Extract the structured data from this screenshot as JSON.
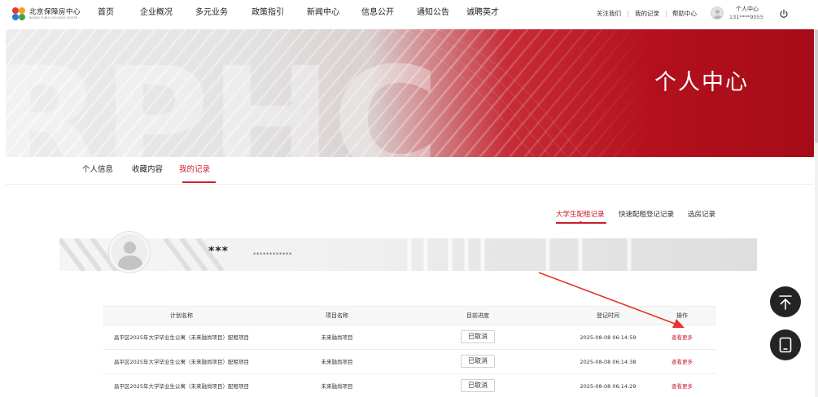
{
  "header": {
    "logo_text": "北京保障房中心",
    "logo_subtext": "BEIJING PUBLIC HOUSING CENTER",
    "nav": [
      "首页",
      "企业概况",
      "多元业务",
      "政策指引",
      "新闻中心",
      "信息公开",
      "通知公告",
      "诚聘英才"
    ],
    "links": [
      "关注我们",
      "我的记录",
      "帮助中心"
    ],
    "user_label": "个人中心",
    "user_phone": "131****9055"
  },
  "banner": {
    "title": "个人中心",
    "watermark": "RPHC"
  },
  "subtabs": {
    "items": [
      "个人信息",
      "收藏内容",
      "我的记录"
    ],
    "active_index": 2
  },
  "record_tabs": {
    "items": [
      "大学生配租记录",
      "快速配租登记记录",
      "选房记录"
    ],
    "active_index": 0
  },
  "profile": {
    "name": "***",
    "id_number": "************"
  },
  "table": {
    "columns": [
      "计划名称",
      "项目名称",
      "目前进度",
      "登记时间",
      "操作"
    ],
    "rows": [
      {
        "plan": "昌平区2025年大学毕业生公寓（未来融尚项目）配租项目",
        "project": "未来融尚项目",
        "status": "已取消",
        "time": "2025-08-08 06:14:59",
        "action": "查看更多"
      },
      {
        "plan": "昌平区2025年大学毕业生公寓（未来融尚项目）配租项目",
        "project": "未来融尚项目",
        "status": "已取消",
        "time": "2025-08-08 06:14:38",
        "action": "查看更多"
      },
      {
        "plan": "昌平区2025年大学毕业生公寓（未来融尚项目）配租项目",
        "project": "未来融尚项目",
        "status": "已取消",
        "time": "2025-08-08 06:14:29",
        "action": "查看更多"
      }
    ]
  },
  "colors": {
    "accent": "#c8202e",
    "banner_red": "#b3101d",
    "fab": "#242424"
  },
  "icons": {
    "back_to_top": "back-to-top-icon",
    "feedback": "tablet-icon",
    "power": "power-icon"
  }
}
